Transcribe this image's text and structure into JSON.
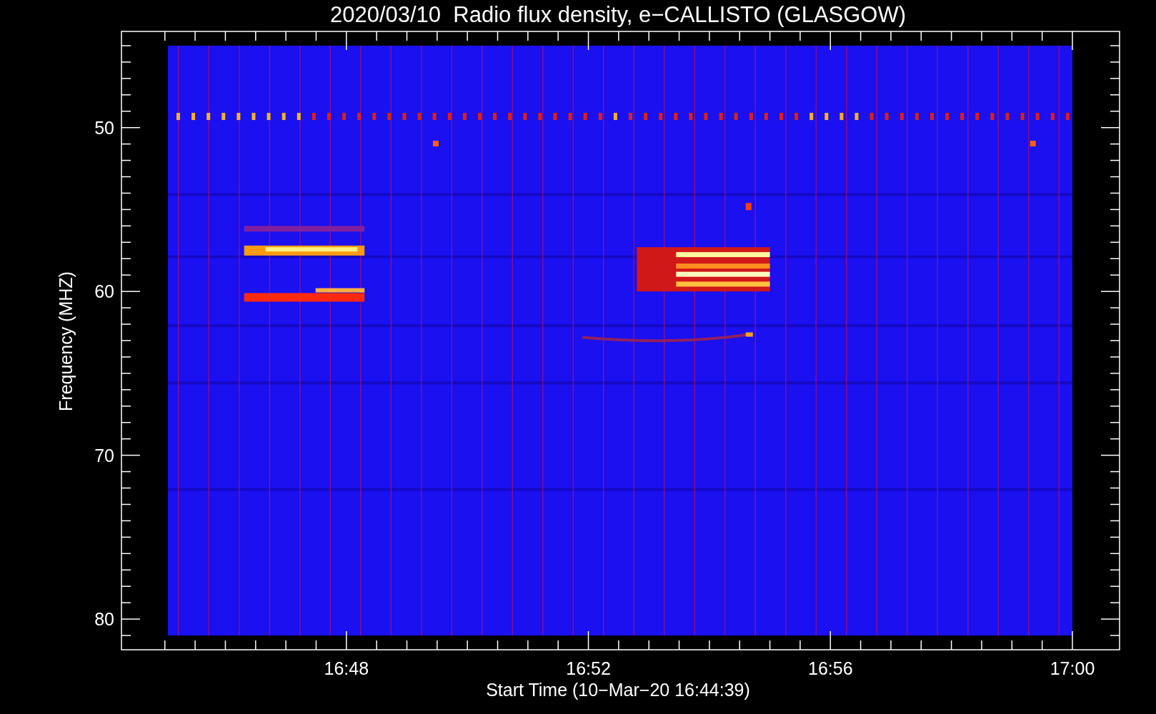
{
  "title": "2020/03/10  Radio flux density, e−CALLISTO (GLASGOW)",
  "y_axis": {
    "label": "Frequency (MHZ)",
    "ticks": [
      "50",
      "60",
      "70",
      "80"
    ]
  },
  "x_axis": {
    "label": "Start Time (10−Mar−20 16:44:39)",
    "ticks": [
      "16:48",
      "16:52",
      "16:56",
      "17:00"
    ]
  }
}
